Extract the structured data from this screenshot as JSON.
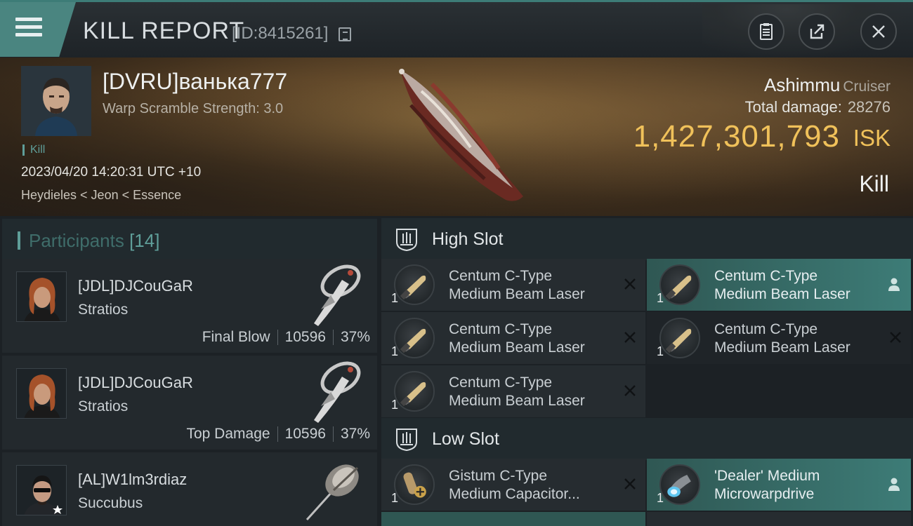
{
  "header": {
    "title": "KILL REPORT",
    "id": "[ID:8415261]",
    "icons": {
      "menu": "hamburger-icon",
      "copy": "copy-icon",
      "report": "clipboard-icon",
      "share": "share-icon",
      "close": "close-icon"
    }
  },
  "victim": {
    "name": "[DVRU]ванька777",
    "warp_scramble": "Warp Scramble Strength: 3.0",
    "tag": "Kill",
    "datetime": "2023/04/20 14:20:31 UTC +10",
    "location": "Heydieles < Jeon < Essence"
  },
  "ship": {
    "name": "Ashimmu",
    "class": "Cruiser",
    "total_damage_label": "Total damage:",
    "total_damage": "28276",
    "isk_value": "1,427,301,793",
    "isk_unit": "ISK",
    "kill_type": "Kill"
  },
  "participants": {
    "title": "Participants",
    "count": "[14]",
    "rows": [
      {
        "name": "[JDL]DJCouGaR",
        "ship": "Stratios",
        "label": "Final Blow",
        "damage": "10596",
        "percent": "37%"
      },
      {
        "name": "[JDL]DJCouGaR",
        "ship": "Stratios",
        "label": "Top Damage",
        "damage": "10596",
        "percent": "37%"
      },
      {
        "name": "[AL]W1lm3rdiaz",
        "ship": "Succubus"
      }
    ]
  },
  "fittings": {
    "high_slot": {
      "title": "High Slot",
      "modules": [
        {
          "qty": "1",
          "line1": "Centum C-Type",
          "line2": "Medium Beam Laser"
        },
        {
          "qty": "1",
          "line1": "Centum C-Type",
          "line2": "Medium Beam Laser"
        },
        {
          "qty": "1",
          "line1": "Centum C-Type",
          "line2": "Medium Beam Laser"
        },
        {
          "qty": "1",
          "line1": "Centum C-Type",
          "line2": "Medium Beam Laser"
        },
        {
          "qty": "1",
          "line1": "Centum C-Type",
          "line2": "Medium Beam Laser"
        }
      ]
    },
    "low_slot": {
      "title": "Low Slot",
      "modules": [
        {
          "qty": "1",
          "line1": "Gistum C-Type",
          "line2": "Medium Capacitor..."
        },
        {
          "qty": "1",
          "line1": "'Dealer' Medium",
          "line2": "Microwarpdrive"
        }
      ]
    }
  },
  "colors": {
    "accent": "#5f9e99",
    "isk": "#f0c15a",
    "active_slot": "#3d7c77"
  }
}
